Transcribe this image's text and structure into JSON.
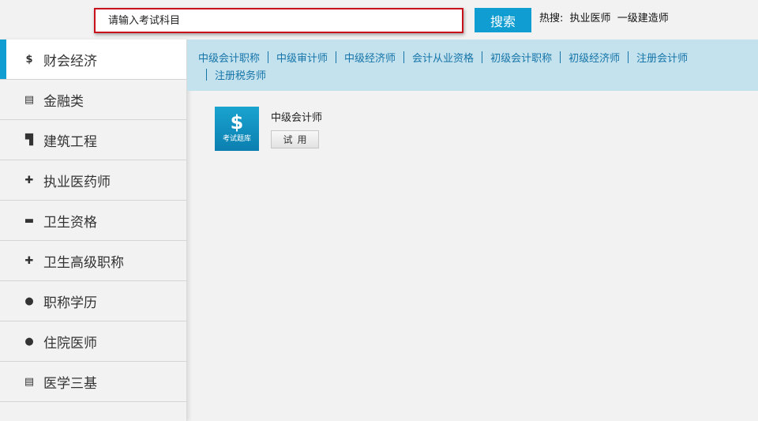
{
  "search": {
    "placeholder": "请输入考试科目",
    "button_label": "搜索"
  },
  "hot_search": {
    "label": "热搜:",
    "items": [
      "执业医师",
      "一级建造师"
    ]
  },
  "sidebar": {
    "items": [
      {
        "label": "财会经济",
        "icon": "dollar-icon",
        "glyph": "$",
        "active": true
      },
      {
        "label": "金融类",
        "icon": "clipboard-icon",
        "glyph": "▤",
        "active": false
      },
      {
        "label": "建筑工程",
        "icon": "hammer-icon",
        "glyph": "▜",
        "active": false
      },
      {
        "label": "执业医药师",
        "icon": "medkit-icon",
        "glyph": "✚",
        "active": false
      },
      {
        "label": "卫生资格",
        "icon": "mask-icon",
        "glyph": "▬",
        "active": false
      },
      {
        "label": "卫生高级职称",
        "icon": "plus-icon",
        "glyph": "✚",
        "active": false
      },
      {
        "label": "职称学历",
        "icon": "user-icon",
        "glyph": "●",
        "active": false
      },
      {
        "label": "住院医师",
        "icon": "doctor-icon",
        "glyph": "●",
        "active": false
      },
      {
        "label": "医学三基",
        "icon": "clipboard-icon",
        "glyph": "▤",
        "active": false
      }
    ]
  },
  "categories": [
    "中级会计职称",
    "中级审计师",
    "中级经济师",
    "会计从业资格",
    "初级会计职称",
    "初级经济师",
    "注册会计师",
    "注册税务师"
  ],
  "card": {
    "icon_glyph": "$",
    "icon_text": "考试题库",
    "title": "中级会计师",
    "button_label": "试用"
  },
  "colors": {
    "accent": "#0f9dd2",
    "highlight_border": "#c8111a",
    "category_bar": "#c4e2ee",
    "category_link": "#1574a8"
  }
}
